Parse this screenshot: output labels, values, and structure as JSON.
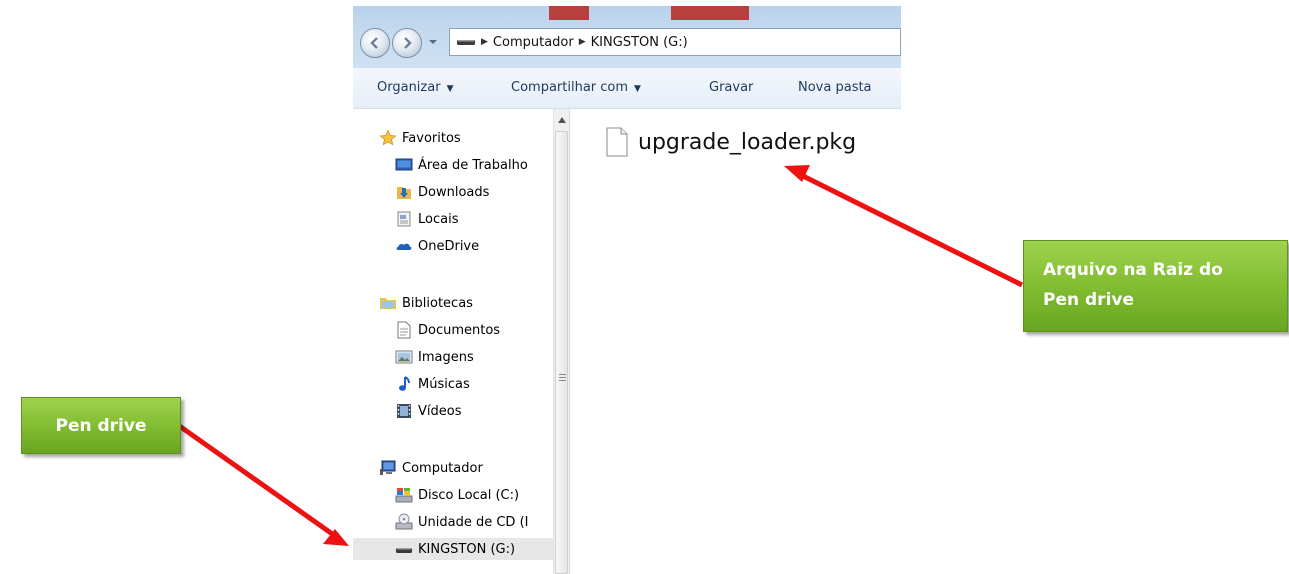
{
  "window": {
    "breadcrumb": [
      "Computador",
      "KINGSTON (G:)"
    ]
  },
  "toolbar": {
    "organize_label": "Organizar",
    "share_label": "Compartilhar com",
    "burn_label": "Gravar",
    "new_folder_label": "Nova pasta"
  },
  "sidebar": {
    "favorites": {
      "label": "Favoritos",
      "items": [
        "Área de Trabalho",
        "Downloads",
        "Locais",
        "OneDrive"
      ]
    },
    "libraries": {
      "label": "Bibliotecas",
      "items": [
        "Documentos",
        "Imagens",
        "Músicas",
        "Vídeos"
      ]
    },
    "computer": {
      "label": "Computador",
      "items": [
        "Disco Local (C:)",
        "Unidade de CD (I",
        "KINGSTON (G:)"
      ],
      "selected": "KINGSTON (G:)"
    }
  },
  "content": {
    "files": [
      {
        "name": "upgrade_loader.pkg",
        "icon": "document-icon"
      }
    ]
  },
  "annotations": {
    "pen_drive_label": "Pen drive",
    "file_callout_line1": "Arquivo na Raiz do",
    "file_callout_line2": "Pen drive",
    "callout_color": "#7fbb2f",
    "arrow_color": "#ee1111"
  },
  "icons": {
    "favorites": "star-icon",
    "desktop": "desktop-icon",
    "downloads": "downloads-icon",
    "places": "recent-places-icon",
    "onedrive": "cloud-icon",
    "libraries": "library-icon",
    "documents": "document-library-icon",
    "pictures": "pictures-icon",
    "music": "music-icon",
    "videos": "video-icon",
    "computer": "computer-icon",
    "local_disk": "hard-disk-icon",
    "cd_drive": "cd-drive-icon",
    "usb_drive": "usb-drive-icon"
  }
}
